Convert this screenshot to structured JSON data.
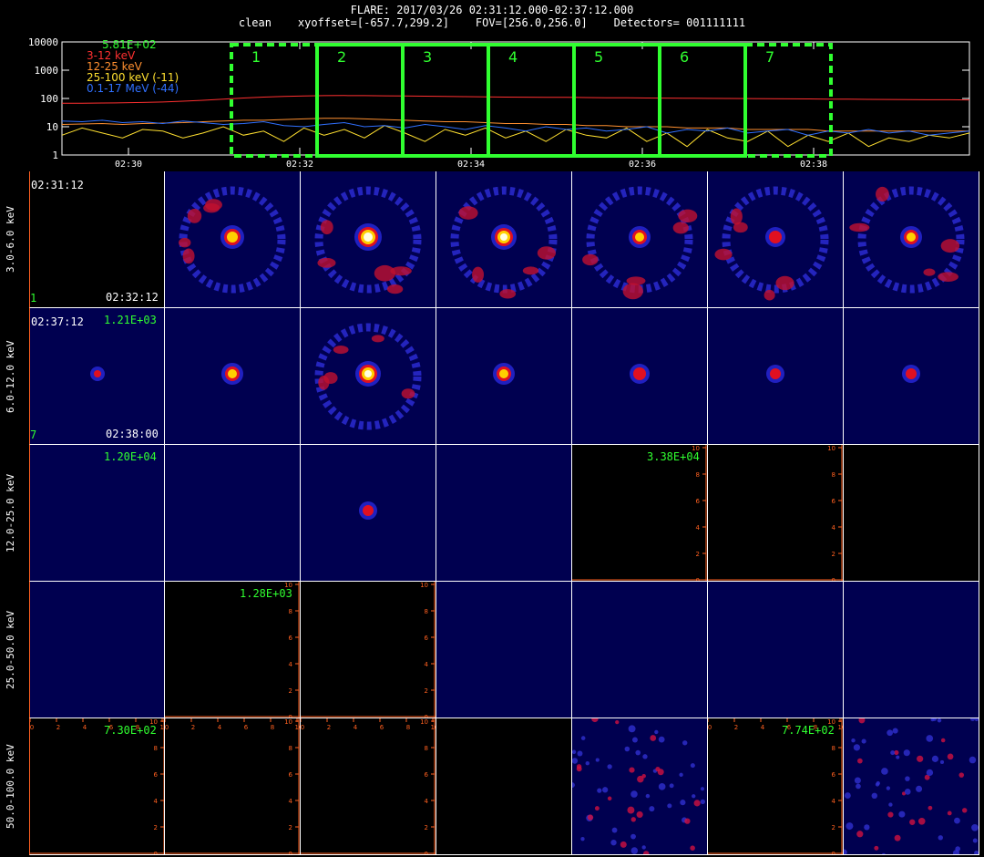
{
  "header": {
    "title": "FLARE: 2017/03/26 02:31:12.000-02:37:12.000",
    "subtitle": "clean    xyoffset=[-657.7,299.2]    FOV=[256.0,256.0]    Detectors= 001111111"
  },
  "chart_data": {
    "type": "line",
    "title": "",
    "ylog": true,
    "ylim": [
      1,
      10000
    ],
    "yticks": [
      "1",
      "10",
      "100",
      "1000",
      "10000"
    ],
    "xtick_labels": [
      "02:30",
      "02:32",
      "02:34",
      "02:36",
      "02:38"
    ],
    "legend_peak": "5.81E+02",
    "series": [
      {
        "name": "3-12 keV",
        "color": "#ff3030",
        "values": [
          68,
          68,
          69,
          70,
          72,
          75,
          80,
          86,
          95,
          104,
          112,
          118,
          123,
          126,
          127,
          126,
          124,
          122,
          120,
          118,
          116,
          114,
          112,
          111,
          110,
          109,
          108,
          106,
          105,
          104,
          103,
          102,
          101,
          100,
          99,
          98,
          97,
          96,
          95,
          94,
          93,
          92,
          91,
          90,
          90,
          89
        ]
      },
      {
        "name": "12-25 keV",
        "color": "#ff9030",
        "values": [
          12,
          12.5,
          13,
          12,
          13,
          13.5,
          14,
          15,
          16,
          17,
          17,
          18,
          19,
          20,
          20,
          19,
          18,
          17,
          16,
          15,
          15,
          14,
          13,
          13,
          12,
          12,
          11,
          11,
          10,
          10,
          10,
          9,
          9,
          9,
          8,
          8,
          8,
          8,
          7,
          7,
          7,
          7,
          7,
          7,
          7,
          7
        ]
      },
      {
        "name": "25-100 keV (-11)",
        "color": "#ffe030",
        "values": [
          5,
          9,
          6,
          4,
          8,
          7,
          4,
          6,
          10,
          5,
          7,
          3,
          9,
          5,
          8,
          4,
          11,
          6,
          3,
          8,
          5,
          9,
          4,
          7,
          3,
          8,
          5,
          4,
          9,
          3,
          6,
          2,
          8,
          4,
          3,
          7,
          2,
          5,
          3,
          6,
          2,
          4,
          3,
          5,
          4,
          6
        ]
      },
      {
        "name": "0.1-17 MeV (-44)",
        "color": "#3070ff",
        "values": [
          16,
          15,
          17,
          14,
          15,
          13,
          16,
          14,
          12,
          13,
          15,
          11,
          10,
          12,
          14,
          10,
          11,
          9,
          12,
          10,
          8,
          11,
          9,
          7,
          10,
          8,
          9,
          7,
          8,
          10,
          6,
          8,
          7,
          9,
          6,
          7,
          8,
          5,
          7,
          6,
          8,
          6,
          7,
          5,
          6,
          7
        ]
      }
    ],
    "intervals": [
      "1",
      "2",
      "3",
      "4",
      "5",
      "6",
      "7"
    ]
  },
  "time_labels": {
    "row1_start": "02:31:12",
    "row1_end": "02:32:12",
    "row2_start": "02:37:12",
    "row2_end": "02:38:00",
    "row1_index": "1",
    "row2_index": "7"
  },
  "rows": [
    {
      "label": "3.0-6.0 keV"
    },
    {
      "label": "6.0-12.0 keV"
    },
    {
      "label": "12.0-25.0 keV"
    },
    {
      "label": "25.0-50.0 keV"
    },
    {
      "label": "50.0-100.0 keV"
    }
  ],
  "peaks": {
    "r2c1": "1.21E+03",
    "r3c1": "1.20E+04",
    "r3c5": "3.38E+04",
    "r4c2": "1.28E+03",
    "r5c1": "7.30E+02",
    "r5c6": "7.74E+02"
  },
  "axis_ticks": [
    "0",
    "2",
    "4",
    "6",
    "8",
    "10"
  ],
  "colors": {
    "background": "#000000",
    "axis": "#ff6020",
    "interval_box": "#30ff30",
    "peak_text": "#30ff30",
    "image_bg": "#000050"
  }
}
